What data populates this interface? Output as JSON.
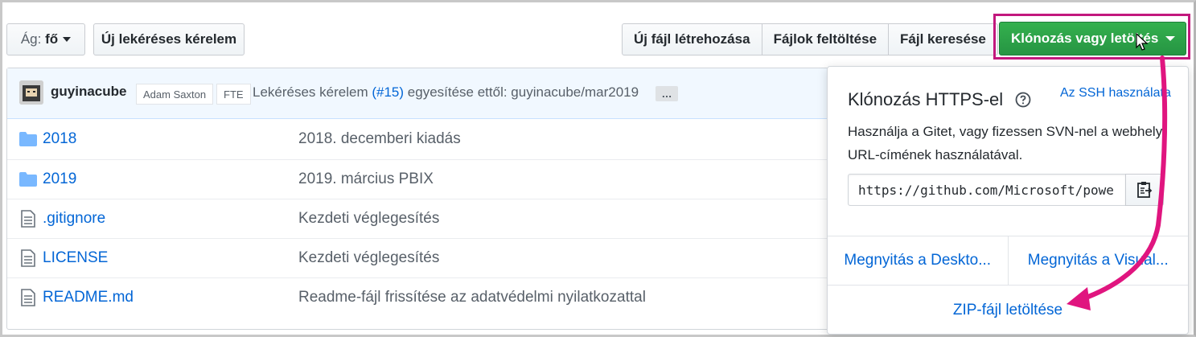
{
  "toolbar": {
    "branch_prefix": "Ág:",
    "branch_name": "fő",
    "new_pull_request": "Új lekéréses kérelem",
    "create_file": "Új fájl létrehozása",
    "upload_files": "Fájlok feltöltése",
    "find_file": "Fájl keresése",
    "clone_download": "Klónozás vagy letöltés"
  },
  "commit": {
    "author": "guyinacube",
    "tags": [
      "Adam Saxton",
      "FTE"
    ],
    "message_prefix": "Lekéréses kérelem",
    "pr_link": "(#15)",
    "message_suffix": "egyesítése ettől: guyinacube/mar2019",
    "ellipsis": "…"
  },
  "files": [
    {
      "icon": "folder-icon",
      "name": "2018",
      "description": "2018. decemberi kiadás"
    },
    {
      "icon": "folder-icon",
      "name": "2019",
      "description": "2019. március PBIX"
    },
    {
      "icon": "file-icon",
      "name": ".gitignore",
      "description": "Kezdeti véglegesítés"
    },
    {
      "icon": "file-icon",
      "name": "LICENSE",
      "description": "Kezdeti véglegesítés"
    },
    {
      "icon": "file-icon",
      "name": "README.md",
      "description": "Readme-fájl frissítése az adatvédelmi nyilatkozattal"
    }
  ],
  "clone_panel": {
    "title": "Klónozás HTTPS-el",
    "ssh_link": "Az SSH használata",
    "description": "Használja a Gitet, vagy fizessen SVN-nel a webhely URL-címének használatával.",
    "url": "https://github.com/Microsoft/powerbi-desktop-samples.git",
    "open_desktop": "Megnyitás a Deskto...",
    "open_visual": "Megnyitás a Visual...",
    "download_zip": "ZIP-fájl letöltése"
  },
  "colors": {
    "accent_green": "#2ea44f",
    "link_blue": "#0366d6",
    "highlight_magenta": "#e0157f"
  }
}
